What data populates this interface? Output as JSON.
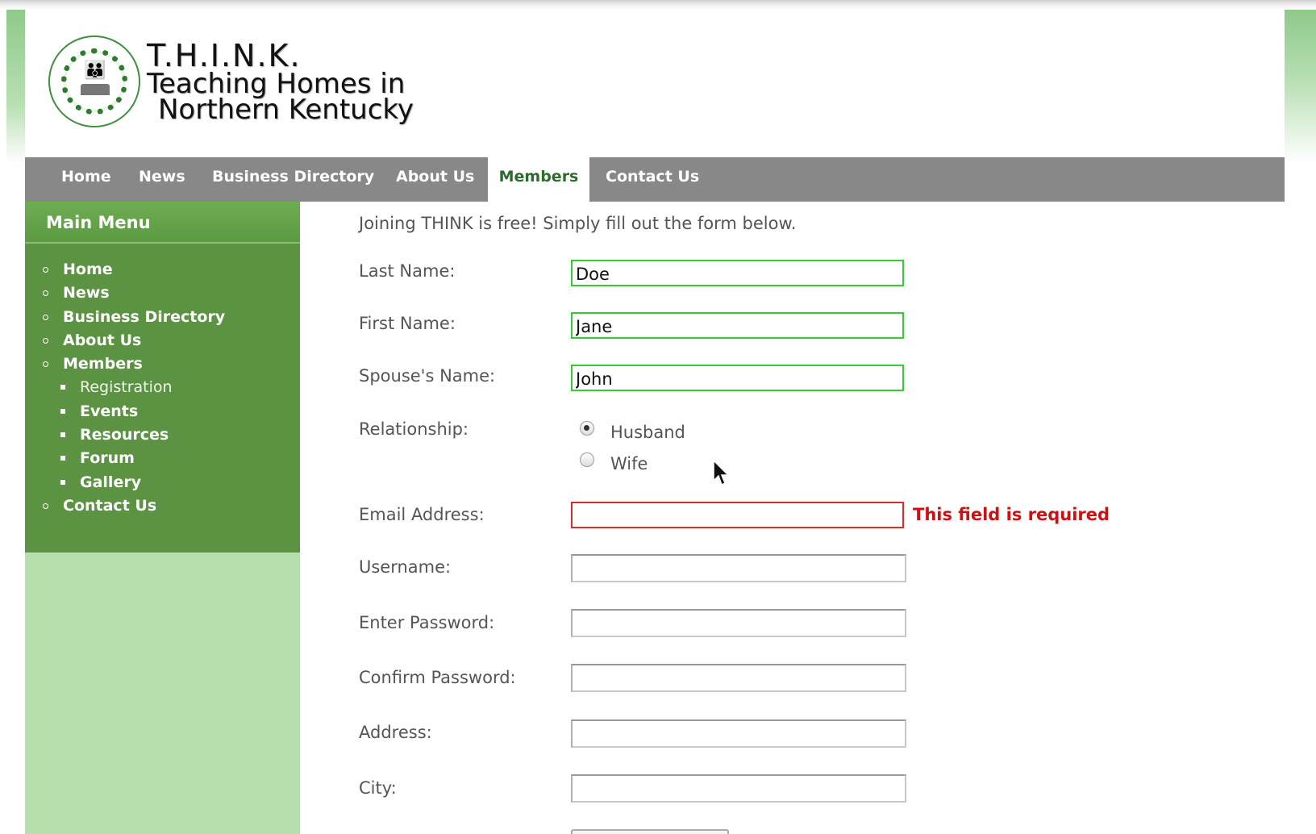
{
  "header": {
    "logo_seal_text": "Teaching Homes in Northern Kentucky",
    "title_line1": "T.H.I.N.K.",
    "title_line2": "Teaching Homes in",
    "title_line3": "Northern Kentucky"
  },
  "nav": {
    "items": [
      {
        "label": "Home"
      },
      {
        "label": "News"
      },
      {
        "label": "Business Directory"
      },
      {
        "label": "About Us"
      },
      {
        "label": "Members",
        "active": true
      },
      {
        "label": "Contact Us"
      }
    ]
  },
  "sidebar": {
    "title": "Main Menu",
    "items": [
      {
        "label": "Home"
      },
      {
        "label": "News"
      },
      {
        "label": "Business Directory"
      },
      {
        "label": "About Us"
      },
      {
        "label": "Members"
      },
      {
        "label": "Registration",
        "sub": true,
        "current": true
      },
      {
        "label": "Events",
        "sub": true
      },
      {
        "label": "Resources",
        "sub": true
      },
      {
        "label": "Forum",
        "sub": true
      },
      {
        "label": "Gallery",
        "sub": true
      },
      {
        "label": "Contact Us"
      }
    ]
  },
  "form": {
    "intro": "Joining THINK is free! Simply fill out the form below.",
    "last_name": {
      "label": "Last Name:",
      "value": "Doe"
    },
    "first_name": {
      "label": "First Name:",
      "value": "Jane"
    },
    "spouse_name": {
      "label": "Spouse's Name:",
      "value": "John"
    },
    "relationship": {
      "label": "Relationship:",
      "options": [
        "Husband",
        "Wife"
      ],
      "selected": "Husband"
    },
    "email": {
      "label": "Email Address:",
      "value": "",
      "error": "This field is required"
    },
    "username": {
      "label": "Username:",
      "value": ""
    },
    "password": {
      "label": "Enter Password:",
      "value": ""
    },
    "confirm_password": {
      "label": "Confirm Password:",
      "value": ""
    },
    "address": {
      "label": "Address:",
      "value": ""
    },
    "city": {
      "label": "City:",
      "value": ""
    }
  },
  "colors": {
    "nav_bg": "#888888",
    "sidebar_menu_bg": "#5b9343",
    "sidebar_bg": "#b6dfae",
    "active_nav_text": "#2e6b2e",
    "valid_border": "#33cc33",
    "error_border": "#dd2a2a",
    "error_text": "#cc1111"
  }
}
